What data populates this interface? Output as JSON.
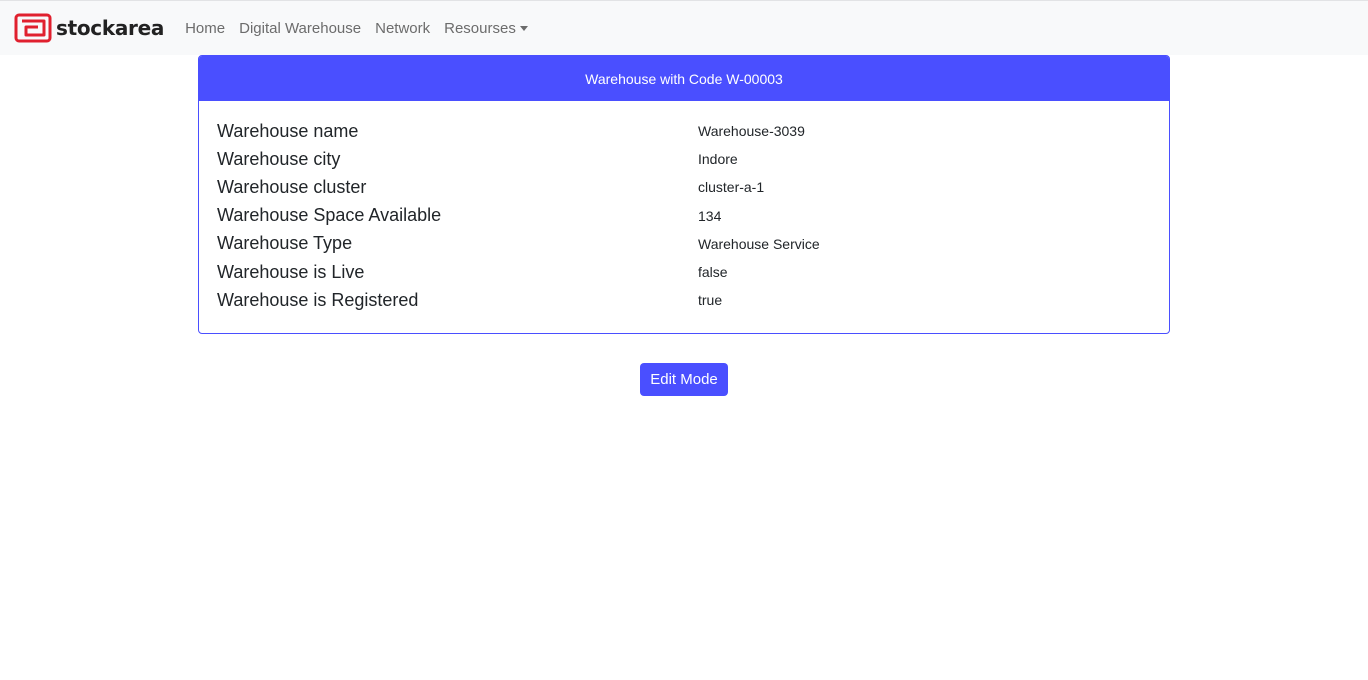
{
  "navbar": {
    "brand": {
      "logo_icon": "stockarea-logo-icon",
      "name": "stockarea",
      "logo_color": "#e0202e"
    },
    "links": [
      {
        "label": "Home"
      },
      {
        "label": "Digital Warehouse"
      },
      {
        "label": "Network"
      },
      {
        "label": "Resourses",
        "icon": "caret-down-icon"
      }
    ]
  },
  "card": {
    "title": "Warehouse with Code W-00003",
    "accent_color": "#4a4fff",
    "rows": [
      {
        "label": "Warehouse name",
        "value": "Warehouse-3039"
      },
      {
        "label": "Warehouse city",
        "value": "Indore"
      },
      {
        "label": "Warehouse cluster",
        "value": "cluster-a-1"
      },
      {
        "label": "Warehouse Space Available",
        "value": "134"
      },
      {
        "label": "Warehouse Type",
        "value": "Warehouse Service"
      },
      {
        "label": "Warehouse is Live",
        "value": "false"
      },
      {
        "label": "Warehouse is Registered",
        "value": "true"
      }
    ]
  },
  "actions": {
    "edit_label": "Edit Mode"
  }
}
